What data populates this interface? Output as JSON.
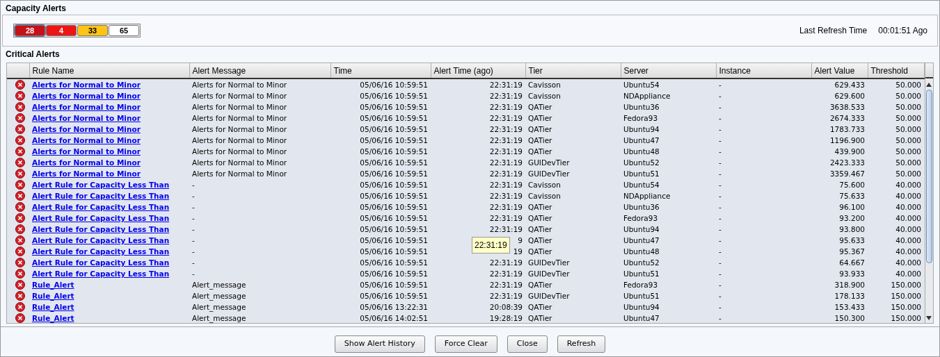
{
  "capacity": {
    "title": "Capacity Alerts",
    "badges": [
      {
        "label": "28",
        "color": "#c81018",
        "selected": true
      },
      {
        "label": "4",
        "color": "#ee1515",
        "selected": false
      },
      {
        "label": "33",
        "color": "#ffc414",
        "selected": false
      },
      {
        "label": "65",
        "color": "#ffffff",
        "selected": false
      }
    ],
    "refresh_label": "Last Refresh Time",
    "refresh_value": "00:01:51 Ago"
  },
  "critical": {
    "title": "Critical Alerts",
    "columns": [
      "Rule Name",
      "Alert Message",
      "Time",
      "Alert Time (ago)",
      "Tier",
      "Server",
      "Instance",
      "Alert Value",
      "Threshold"
    ],
    "rows": [
      [
        "Alerts for Normal to Minor",
        "Alerts for Normal to Minor",
        "05/06/16 10:59:51",
        "22:31:19",
        "Cavisson",
        "Ubuntu54",
        "-",
        "629.433",
        "50.000"
      ],
      [
        "Alerts for Normal to Minor",
        "Alerts for Normal to Minor",
        "05/06/16 10:59:51",
        "22:31:19",
        "Cavisson",
        "NDAppliance",
        "-",
        "629.600",
        "50.000"
      ],
      [
        "Alerts for Normal to Minor",
        "Alerts for Normal to Minor",
        "05/06/16 10:59:51",
        "22:31:19",
        "QATier",
        "Ubuntu36",
        "-",
        "3638.533",
        "50.000"
      ],
      [
        "Alerts for Normal to Minor",
        "Alerts for Normal to Minor",
        "05/06/16 10:59:51",
        "22:31:19",
        "QATier",
        "Fedora93",
        "-",
        "2674.333",
        "50.000"
      ],
      [
        "Alerts for Normal to Minor",
        "Alerts for Normal to Minor",
        "05/06/16 10:59:51",
        "22:31:19",
        "QATier",
        "Ubuntu94",
        "-",
        "1783.733",
        "50.000"
      ],
      [
        "Alerts for Normal to Minor",
        "Alerts for Normal to Minor",
        "05/06/16 10:59:51",
        "22:31:19",
        "QATier",
        "Ubuntu47",
        "-",
        "1196.900",
        "50.000"
      ],
      [
        "Alerts for Normal to Minor",
        "Alerts for Normal to Minor",
        "05/06/16 10:59:51",
        "22:31:19",
        "QATier",
        "Ubuntu48",
        "-",
        "439.900",
        "50.000"
      ],
      [
        "Alerts for Normal to Minor",
        "Alerts for Normal to Minor",
        "05/06/16 10:59:51",
        "22:31:19",
        "GUIDevTier",
        "Ubuntu52",
        "-",
        "2423.333",
        "50.000"
      ],
      [
        "Alerts for Normal to Minor",
        "Alerts for Normal to Minor",
        "05/06/16 10:59:51",
        "22:31:19",
        "GUIDevTier",
        "Ubuntu51",
        "-",
        "3359.467",
        "50.000"
      ],
      [
        "Alert Rule for Capacity Less Than",
        "-",
        "05/06/16 10:59:51",
        "22:31:19",
        "Cavisson",
        "Ubuntu54",
        "-",
        "75.600",
        "40.000"
      ],
      [
        "Alert Rule for Capacity Less Than",
        "-",
        "05/06/16 10:59:51",
        "22:31:19",
        "Cavisson",
        "NDAppliance",
        "-",
        "75.633",
        "40.000"
      ],
      [
        "Alert Rule for Capacity Less Than",
        "-",
        "05/06/16 10:59:51",
        "22:31:19",
        "QATier",
        "Ubuntu36",
        "-",
        "96.100",
        "40.000"
      ],
      [
        "Alert Rule for Capacity Less Than",
        "-",
        "05/06/16 10:59:51",
        "22:31:19",
        "QATier",
        "Fedora93",
        "-",
        "93.200",
        "40.000"
      ],
      [
        "Alert Rule for Capacity Less Than",
        "-",
        "05/06/16 10:59:51",
        "22:31:19",
        "QATier",
        "Ubuntu94",
        "-",
        "93.800",
        "40.000"
      ],
      [
        "Alert Rule for Capacity Less Than",
        "-",
        "05/06/16 10:59:51",
        "9",
        "QATier",
        "Ubuntu47",
        "-",
        "95.633",
        "40.000"
      ],
      [
        "Alert Rule for Capacity Less Than",
        "-",
        "05/06/16 10:59:51",
        "19",
        "QATier",
        "Ubuntu48",
        "-",
        "95.367",
        "40.000"
      ],
      [
        "Alert Rule for Capacity Less Than",
        "-",
        "05/06/16 10:59:51",
        "22:31:19",
        "GUIDevTier",
        "Ubuntu52",
        "-",
        "64.667",
        "40.000"
      ],
      [
        "Alert Rule for Capacity Less Than",
        "-",
        "05/06/16 10:59:51",
        "22:31:19",
        "GUIDevTier",
        "Ubuntu51",
        "-",
        "93.933",
        "40.000"
      ],
      [
        "Rule_Alert",
        "Alert_message",
        "05/06/16 10:59:51",
        "22:31:19",
        "QATier",
        "Fedora93",
        "-",
        "318.900",
        "150.000"
      ],
      [
        "Rule_Alert",
        "Alert_message",
        "05/06/16 10:59:51",
        "22:31:19",
        "GUIDevTier",
        "Ubuntu51",
        "-",
        "178.133",
        "150.000"
      ],
      [
        "Rule_Alert",
        "Alert_message",
        "05/06/16 13:22:31",
        "20:08:39",
        "QATier",
        "Ubuntu94",
        "-",
        "153.433",
        "150.000"
      ],
      [
        "Rule_Alert",
        "Alert_message",
        "05/06/16 14:02:51",
        "19:28:19",
        "QATier",
        "Ubuntu47",
        "-",
        "150.300",
        "150.000"
      ]
    ],
    "tooltip": "22:31:19"
  },
  "buttons": [
    "Show Alert History",
    "Force Clear",
    "Close",
    "Refresh"
  ]
}
